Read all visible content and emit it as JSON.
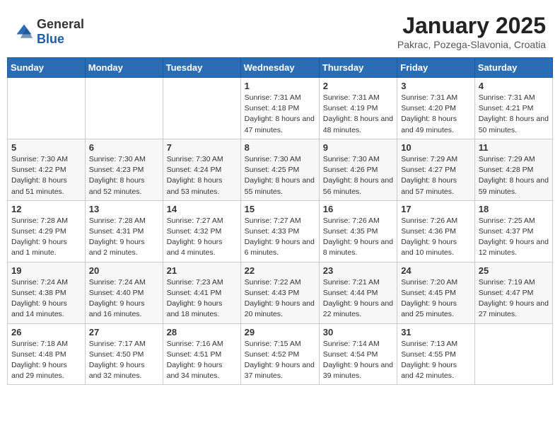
{
  "header": {
    "logo_general": "General",
    "logo_blue": "Blue",
    "month": "January 2025",
    "location": "Pakrac, Pozega-Slavonia, Croatia"
  },
  "days_of_week": [
    "Sunday",
    "Monday",
    "Tuesday",
    "Wednesday",
    "Thursday",
    "Friday",
    "Saturday"
  ],
  "weeks": [
    [
      {
        "day": "",
        "info": ""
      },
      {
        "day": "",
        "info": ""
      },
      {
        "day": "",
        "info": ""
      },
      {
        "day": "1",
        "info": "Sunrise: 7:31 AM\nSunset: 4:18 PM\nDaylight: 8 hours and 47 minutes."
      },
      {
        "day": "2",
        "info": "Sunrise: 7:31 AM\nSunset: 4:19 PM\nDaylight: 8 hours and 48 minutes."
      },
      {
        "day": "3",
        "info": "Sunrise: 7:31 AM\nSunset: 4:20 PM\nDaylight: 8 hours and 49 minutes."
      },
      {
        "day": "4",
        "info": "Sunrise: 7:31 AM\nSunset: 4:21 PM\nDaylight: 8 hours and 50 minutes."
      }
    ],
    [
      {
        "day": "5",
        "info": "Sunrise: 7:30 AM\nSunset: 4:22 PM\nDaylight: 8 hours and 51 minutes."
      },
      {
        "day": "6",
        "info": "Sunrise: 7:30 AM\nSunset: 4:23 PM\nDaylight: 8 hours and 52 minutes."
      },
      {
        "day": "7",
        "info": "Sunrise: 7:30 AM\nSunset: 4:24 PM\nDaylight: 8 hours and 53 minutes."
      },
      {
        "day": "8",
        "info": "Sunrise: 7:30 AM\nSunset: 4:25 PM\nDaylight: 8 hours and 55 minutes."
      },
      {
        "day": "9",
        "info": "Sunrise: 7:30 AM\nSunset: 4:26 PM\nDaylight: 8 hours and 56 minutes."
      },
      {
        "day": "10",
        "info": "Sunrise: 7:29 AM\nSunset: 4:27 PM\nDaylight: 8 hours and 57 minutes."
      },
      {
        "day": "11",
        "info": "Sunrise: 7:29 AM\nSunset: 4:28 PM\nDaylight: 8 hours and 59 minutes."
      }
    ],
    [
      {
        "day": "12",
        "info": "Sunrise: 7:28 AM\nSunset: 4:29 PM\nDaylight: 9 hours and 1 minute."
      },
      {
        "day": "13",
        "info": "Sunrise: 7:28 AM\nSunset: 4:31 PM\nDaylight: 9 hours and 2 minutes."
      },
      {
        "day": "14",
        "info": "Sunrise: 7:27 AM\nSunset: 4:32 PM\nDaylight: 9 hours and 4 minutes."
      },
      {
        "day": "15",
        "info": "Sunrise: 7:27 AM\nSunset: 4:33 PM\nDaylight: 9 hours and 6 minutes."
      },
      {
        "day": "16",
        "info": "Sunrise: 7:26 AM\nSunset: 4:35 PM\nDaylight: 9 hours and 8 minutes."
      },
      {
        "day": "17",
        "info": "Sunrise: 7:26 AM\nSunset: 4:36 PM\nDaylight: 9 hours and 10 minutes."
      },
      {
        "day": "18",
        "info": "Sunrise: 7:25 AM\nSunset: 4:37 PM\nDaylight: 9 hours and 12 minutes."
      }
    ],
    [
      {
        "day": "19",
        "info": "Sunrise: 7:24 AM\nSunset: 4:38 PM\nDaylight: 9 hours and 14 minutes."
      },
      {
        "day": "20",
        "info": "Sunrise: 7:24 AM\nSunset: 4:40 PM\nDaylight: 9 hours and 16 minutes."
      },
      {
        "day": "21",
        "info": "Sunrise: 7:23 AM\nSunset: 4:41 PM\nDaylight: 9 hours and 18 minutes."
      },
      {
        "day": "22",
        "info": "Sunrise: 7:22 AM\nSunset: 4:43 PM\nDaylight: 9 hours and 20 minutes."
      },
      {
        "day": "23",
        "info": "Sunrise: 7:21 AM\nSunset: 4:44 PM\nDaylight: 9 hours and 22 minutes."
      },
      {
        "day": "24",
        "info": "Sunrise: 7:20 AM\nSunset: 4:45 PM\nDaylight: 9 hours and 25 minutes."
      },
      {
        "day": "25",
        "info": "Sunrise: 7:19 AM\nSunset: 4:47 PM\nDaylight: 9 hours and 27 minutes."
      }
    ],
    [
      {
        "day": "26",
        "info": "Sunrise: 7:18 AM\nSunset: 4:48 PM\nDaylight: 9 hours and 29 minutes."
      },
      {
        "day": "27",
        "info": "Sunrise: 7:17 AM\nSunset: 4:50 PM\nDaylight: 9 hours and 32 minutes."
      },
      {
        "day": "28",
        "info": "Sunrise: 7:16 AM\nSunset: 4:51 PM\nDaylight: 9 hours and 34 minutes."
      },
      {
        "day": "29",
        "info": "Sunrise: 7:15 AM\nSunset: 4:52 PM\nDaylight: 9 hours and 37 minutes."
      },
      {
        "day": "30",
        "info": "Sunrise: 7:14 AM\nSunset: 4:54 PM\nDaylight: 9 hours and 39 minutes."
      },
      {
        "day": "31",
        "info": "Sunrise: 7:13 AM\nSunset: 4:55 PM\nDaylight: 9 hours and 42 minutes."
      },
      {
        "day": "",
        "info": ""
      }
    ]
  ]
}
